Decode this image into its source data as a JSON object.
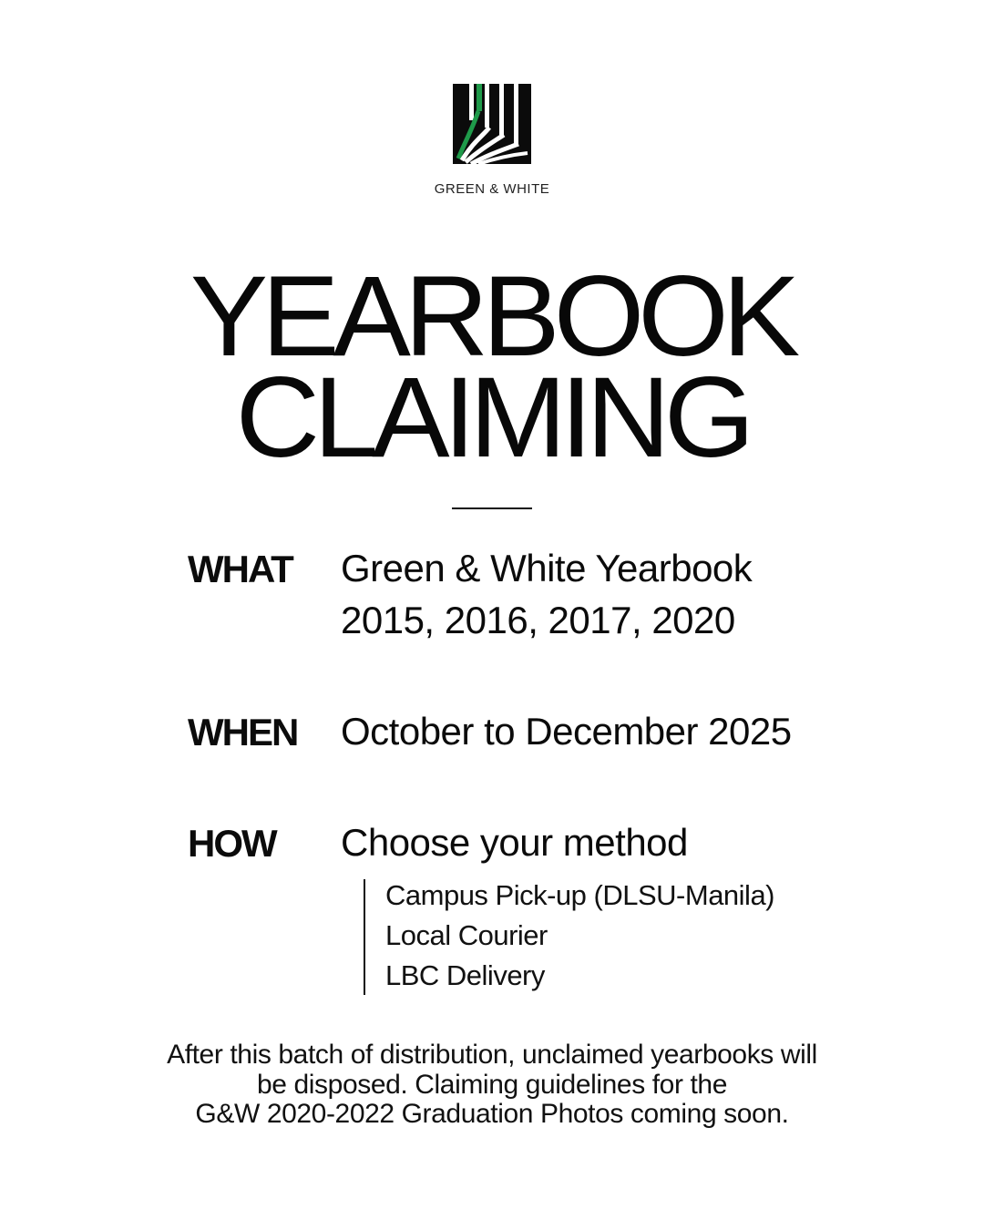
{
  "brand": {
    "logo_icon": "green-and-white-book-logo-icon",
    "name": "GREEN & WHITE",
    "colors": {
      "green": "#1f9a4a",
      "black": "#0b0b0b"
    }
  },
  "title": {
    "line1": "YEARBOOK",
    "line2": "CLAIMING"
  },
  "details": {
    "what": {
      "label": "WHAT",
      "line1": "Green & White Yearbook",
      "line2": "2015, 2016, 2017, 2020"
    },
    "when": {
      "label": "WHEN",
      "value": "October to December 2025"
    },
    "how": {
      "label": "HOW",
      "value": "Choose your method",
      "methods": [
        "Campus Pick-up (DLSU-Manila)",
        "Local Courier",
        "LBC Delivery"
      ]
    }
  },
  "footer": {
    "line1": "After this batch of distribution, unclaimed yearbooks will",
    "line2": "be disposed. Claiming guidelines for the",
    "line3": "G&W 2020-2022 Graduation Photos coming soon."
  }
}
